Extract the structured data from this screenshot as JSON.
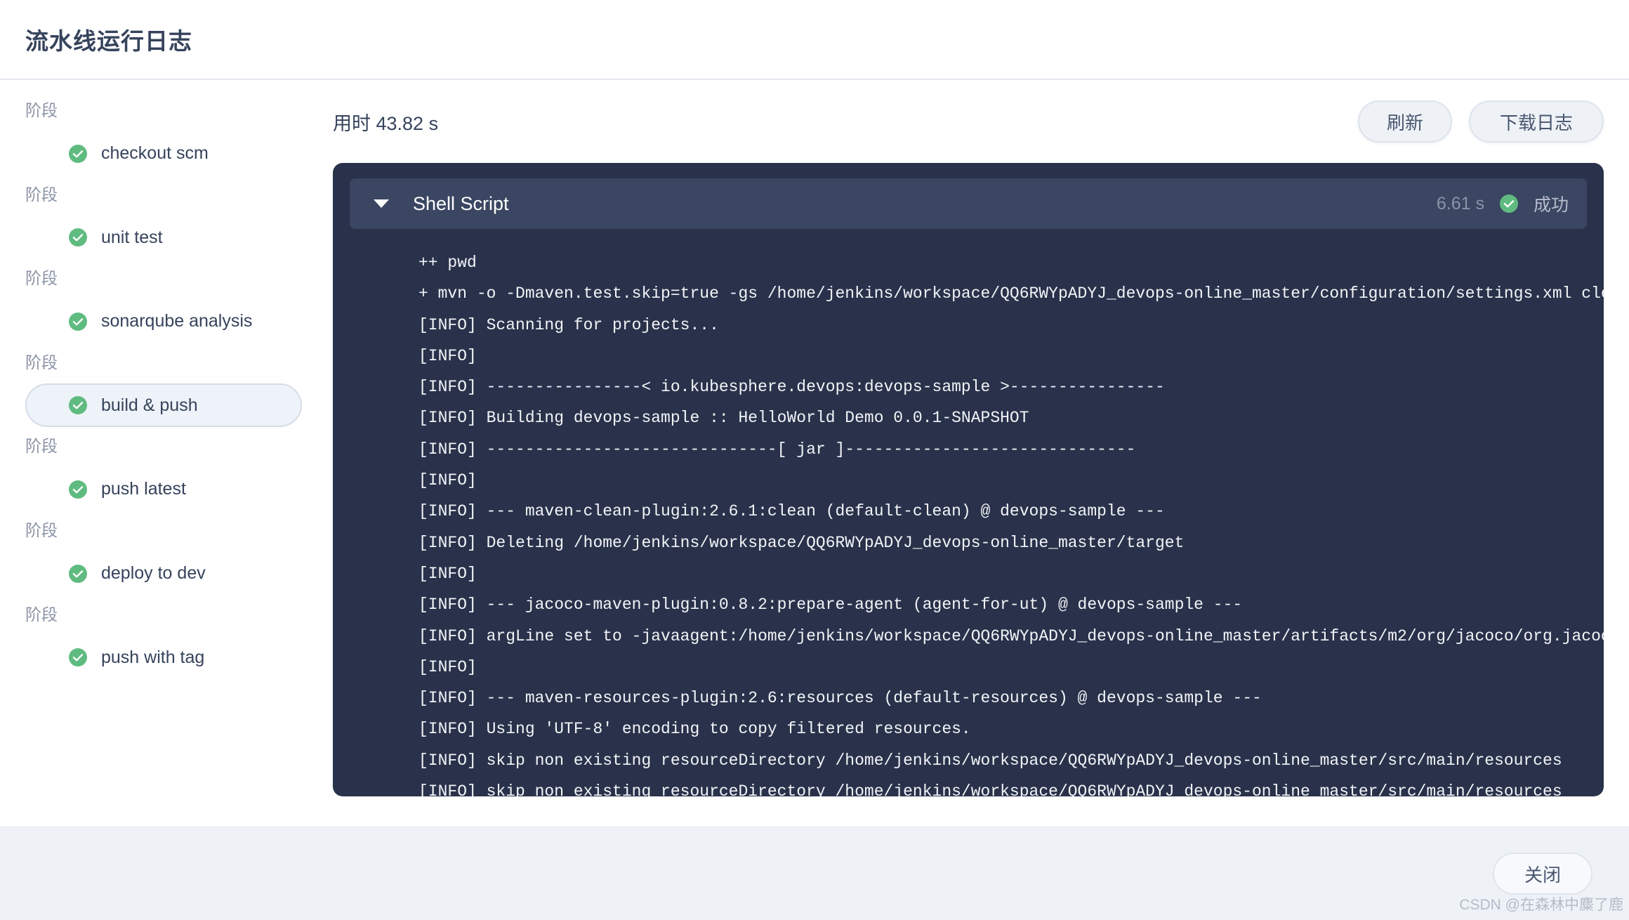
{
  "window": {
    "title": "流水线运行日志"
  },
  "sidebar": {
    "stage_label": "阶段",
    "stages": [
      {
        "label": "阶段",
        "name": "checkout scm",
        "status": "success",
        "selected": false
      },
      {
        "label": "阶段",
        "name": "unit test",
        "status": "success",
        "selected": false
      },
      {
        "label": "阶段",
        "name": "sonarqube analysis",
        "status": "success",
        "selected": false
      },
      {
        "label": "阶段",
        "name": "build & push",
        "status": "success",
        "selected": true
      },
      {
        "label": "阶段",
        "name": "push latest",
        "status": "success",
        "selected": false
      },
      {
        "label": "阶段",
        "name": "deploy to dev",
        "status": "success",
        "selected": false
      },
      {
        "label": "阶段",
        "name": "push with tag",
        "status": "success",
        "selected": false
      }
    ]
  },
  "main": {
    "elapsed": "用时 43.82 s",
    "refresh_label": "刷新",
    "download_label": "下载日志",
    "step": {
      "title": "Shell Script",
      "duration": "6.61 s",
      "status": "成功",
      "expanded": true
    },
    "log_lines": [
      "++ pwd",
      "+ mvn -o -Dmaven.test.skip=true -gs /home/jenkins/workspace/QQ6RWYpADYJ_devops-online_master/configuration/settings.xml clean pack",
      "[INFO] Scanning for projects...",
      "[INFO]",
      "[INFO] ----------------< io.kubesphere.devops:devops-sample >----------------",
      "[INFO] Building devops-sample :: HelloWorld Demo 0.0.1-SNAPSHOT",
      "[INFO] ------------------------------[ jar ]------------------------------",
      "[INFO]",
      "[INFO] --- maven-clean-plugin:2.6.1:clean (default-clean) @ devops-sample ---",
      "[INFO] Deleting /home/jenkins/workspace/QQ6RWYpADYJ_devops-online_master/target",
      "[INFO]",
      "[INFO] --- jacoco-maven-plugin:0.8.2:prepare-agent (agent-for-ut) @ devops-sample ---",
      "[INFO] argLine set to -javaagent:/home/jenkins/workspace/QQ6RWYpADYJ_devops-online_master/artifacts/m2/org/jacoco/org.jacoco.agent",
      "[INFO]",
      "[INFO] --- maven-resources-plugin:2.6:resources (default-resources) @ devops-sample ---",
      "[INFO] Using 'UTF-8' encoding to copy filtered resources.",
      "[INFO] skip non existing resourceDirectory /home/jenkins/workspace/QQ6RWYpADYJ_devops-online_master/src/main/resources",
      "[INFO] skip non existing resourceDirectory /home/jenkins/workspace/QQ6RWYpADYJ_devops-online_master/src/main/resources"
    ]
  },
  "footer": {
    "close_label": "关闭"
  },
  "watermark": "CSDN @在森林中麋了鹿",
  "colors": {
    "success_green": "#60bb80",
    "panel_dark": "#29324a",
    "step_header": "#3b4662",
    "text_primary": "#36435c",
    "text_muted": "#8a93a5",
    "selected_bg": "#eef3f9"
  }
}
